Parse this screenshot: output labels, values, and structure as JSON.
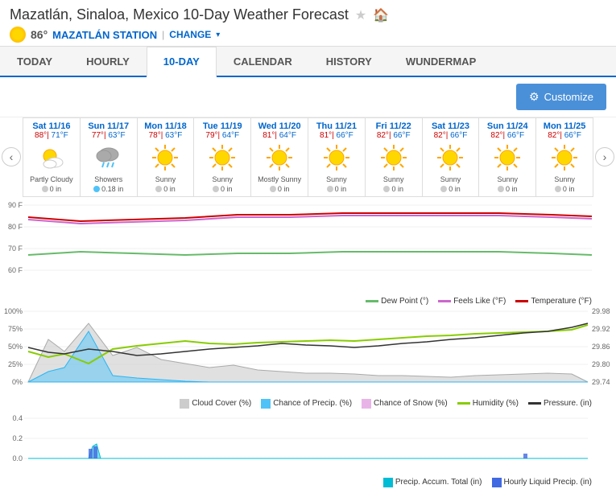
{
  "header": {
    "title": "Mazatlán, Sinaloa, Mexico 10-Day Weather Forecast",
    "star_label": "★",
    "home_label": "🏠",
    "temperature": "86°",
    "station": "MAZATLÁN STATION",
    "change_label": "CHANGE",
    "change_chevron": "▾"
  },
  "nav": {
    "tabs": [
      "TODAY",
      "HOURLY",
      "10-DAY",
      "CALENDAR",
      "HISTORY",
      "WUNDERMAP"
    ],
    "active": "10-DAY"
  },
  "toolbar": {
    "customize_label": "Customize",
    "gear": "⚙"
  },
  "forecast": {
    "days": [
      {
        "label": "Sat 11/16",
        "high": "88°",
        "low": "71°F",
        "condition": "Partly Cloudy",
        "precip": "0 in",
        "icon": "partly_cloudy"
      },
      {
        "label": "Sun 11/17",
        "high": "77°",
        "low": "63°F",
        "condition": "Showers",
        "precip": "0.18 in",
        "icon": "rain"
      },
      {
        "label": "Mon 11/18",
        "high": "78°",
        "low": "63°F",
        "condition": "Sunny",
        "precip": "0 in",
        "icon": "sunny"
      },
      {
        "label": "Tue 11/19",
        "high": "79°",
        "low": "64°F",
        "condition": "Sunny",
        "precip": "0 in",
        "icon": "sunny"
      },
      {
        "label": "Wed 11/20",
        "high": "81°",
        "low": "64°F",
        "condition": "Mostly Sunny",
        "precip": "0 in",
        "icon": "mostly_sunny"
      },
      {
        "label": "Thu 11/21",
        "high": "81°",
        "low": "66°F",
        "condition": "Sunny",
        "precip": "0 in",
        "icon": "sunny"
      },
      {
        "label": "Fri 11/22",
        "high": "82°",
        "low": "66°F",
        "condition": "Sunny",
        "precip": "0 in",
        "icon": "sunny"
      },
      {
        "label": "Sat 11/23",
        "high": "82°",
        "low": "66°F",
        "condition": "Sunny",
        "precip": "0 in",
        "icon": "sunny"
      },
      {
        "label": "Sun 11/24",
        "high": "82°",
        "low": "66°F",
        "condition": "Sunny",
        "precip": "0 in",
        "icon": "sunny"
      },
      {
        "label": "Mon 11/25",
        "high": "82°",
        "low": "66°F",
        "condition": "Sunny",
        "precip": "0 in",
        "icon": "sunny"
      }
    ]
  },
  "chart1": {
    "y_labels": [
      "90 F",
      "80 F",
      "70 F",
      "60 F"
    ],
    "legend": [
      {
        "label": "Dew Point (°)",
        "color": "#66bb6a"
      },
      {
        "label": "Feels Like (°F)",
        "color": "#cc66cc"
      },
      {
        "label": "Temperature (°F)",
        "color": "#cc0000"
      }
    ]
  },
  "chart2": {
    "y_labels": [
      "100%",
      "75%",
      "50%",
      "25%",
      "0%"
    ],
    "y_labels_right": [
      "29.98",
      "29.92",
      "29.86",
      "29.80",
      "29.74"
    ],
    "legend": [
      {
        "label": "Cloud Cover (%)",
        "color": "#aaaaaa"
      },
      {
        "label": "Chance of Precip. (%)",
        "color": "#4fc3f7"
      },
      {
        "label": "Chance of Snow (%)",
        "color": "#e8b4e8"
      },
      {
        "label": "Humidity (%)",
        "color": "#88cc00"
      },
      {
        "label": "Pressure. (in)",
        "color": "#333333"
      }
    ]
  },
  "chart3": {
    "y_labels": [
      "0.4",
      "0.2",
      "0.0"
    ],
    "legend": [
      {
        "label": "Precip. Accum. Total (in)",
        "color": "#00bcd4"
      },
      {
        "label": "Hourly Liquid Precip. (in)",
        "color": "#4169e1"
      }
    ]
  },
  "arrows": {
    "left": "‹",
    "right": "›"
  }
}
